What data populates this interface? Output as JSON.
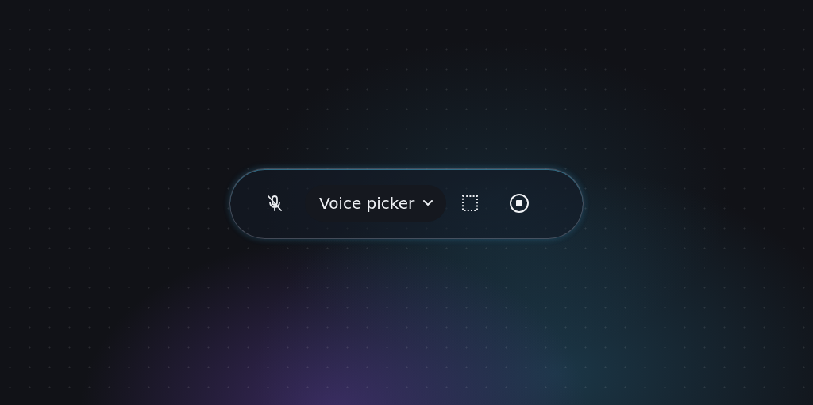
{
  "toolbar": {
    "mic_muted": true,
    "voice_picker": {
      "label": "Voice picker"
    }
  }
}
